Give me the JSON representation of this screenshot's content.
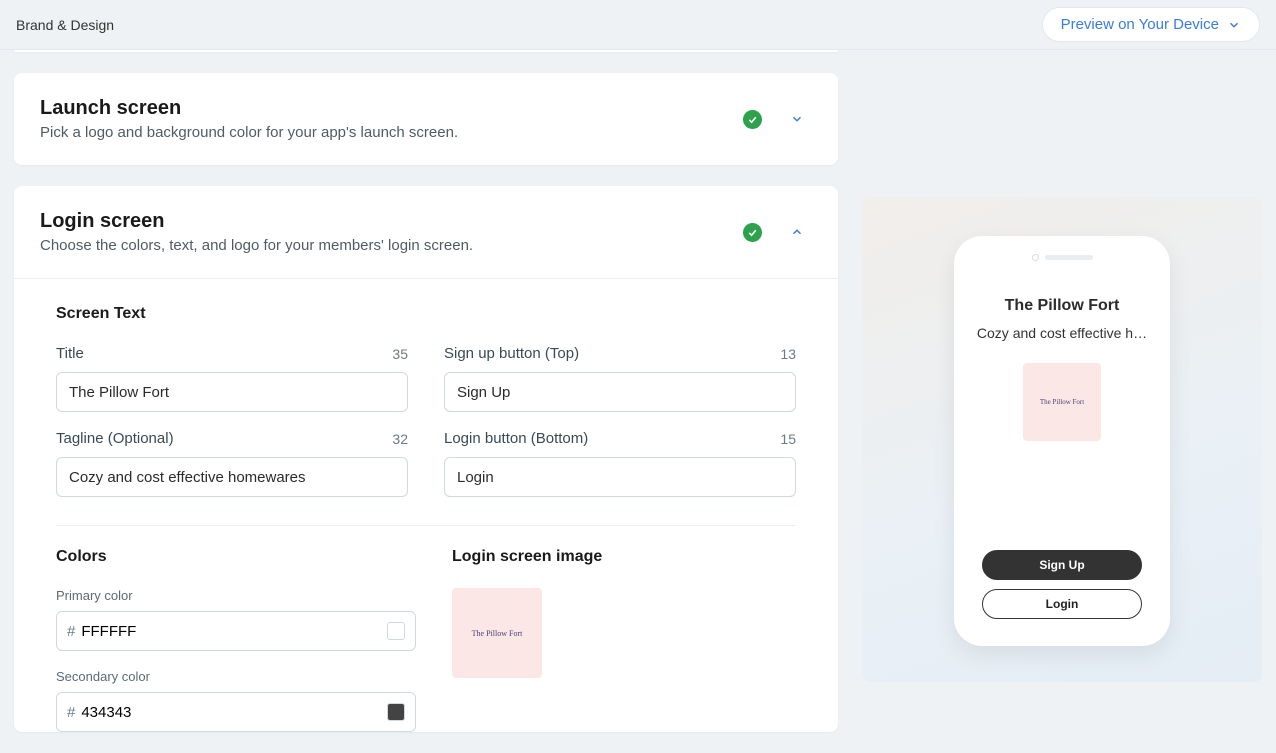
{
  "header": {
    "title": "Brand & Design",
    "preview_button": "Preview on Your Device"
  },
  "sections": {
    "launch": {
      "title": "Launch screen",
      "desc": "Pick a logo and background color for your app's launch screen."
    },
    "login": {
      "title": "Login screen",
      "desc": "Choose the colors, text, and logo for your members' login screen.",
      "screen_text_heading": "Screen Text",
      "fields": {
        "title": {
          "label": "Title",
          "count": "35",
          "value": "The Pillow Fort"
        },
        "signup": {
          "label": "Sign up button (Top)",
          "count": "13",
          "value": "Sign Up"
        },
        "tagline": {
          "label": "Tagline (Optional)",
          "count": "32",
          "value": "Cozy and cost effective homewares"
        },
        "loginbtn": {
          "label": "Login button (Bottom)",
          "count": "15",
          "value": "Login"
        }
      },
      "colors": {
        "heading": "Colors",
        "primary": {
          "label": "Primary color",
          "value": "FFFFFF",
          "hex": "#FFFFFF"
        },
        "secondary": {
          "label": "Secondary color",
          "value": "434343",
          "hex": "#434343"
        }
      },
      "image_heading": "Login screen image",
      "image_text": "The Pillow Fort"
    }
  },
  "preview": {
    "title": "The Pillow Fort",
    "tagline": "Cozy and cost effective h…",
    "logo_text": "The Pillow Fort",
    "signup": "Sign Up",
    "login": "Login"
  }
}
